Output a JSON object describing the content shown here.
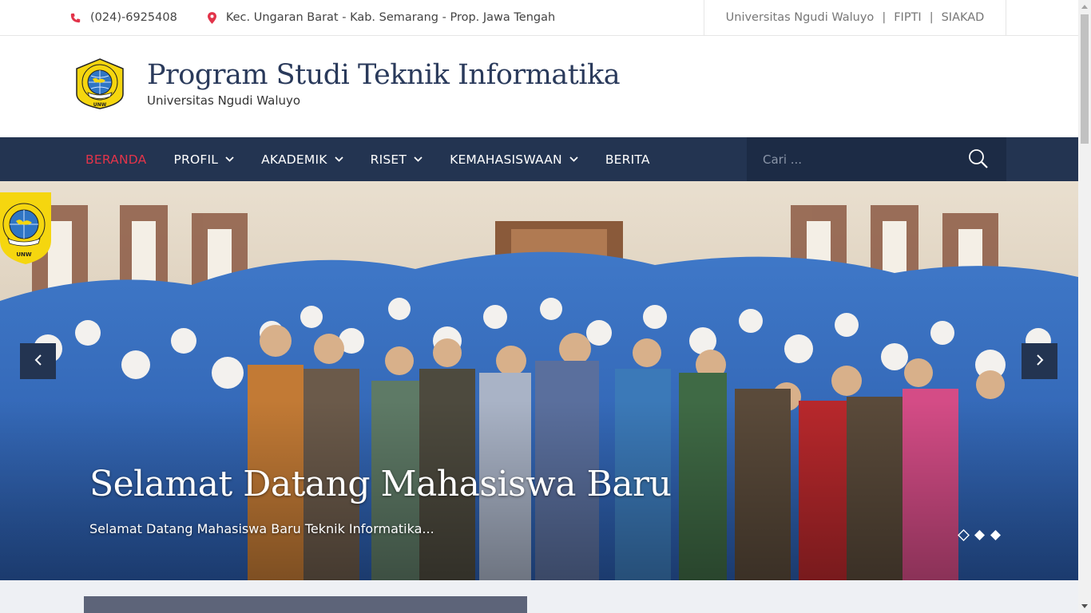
{
  "topbar": {
    "phone": "(024)-6925408",
    "address": "Kec. Ungaran Barat - Kab. Semarang - Prop. Jawa Tengah",
    "links": [
      "Universitas Ngudi Waluyo",
      "FIPTI",
      "SIAKAD"
    ],
    "separator": "|"
  },
  "header": {
    "title": "Program Studi Teknik Informatika",
    "subtitle": "Universitas Ngudi Waluyo",
    "logo_text": "UNW"
  },
  "nav": {
    "items": [
      {
        "label": "BERANDA",
        "active": true,
        "dropdown": false
      },
      {
        "label": "PROFIL",
        "active": false,
        "dropdown": true
      },
      {
        "label": "AKADEMIK",
        "active": false,
        "dropdown": true
      },
      {
        "label": "RISET",
        "active": false,
        "dropdown": true
      },
      {
        "label": "KEMAHASISWAAN",
        "active": false,
        "dropdown": true
      },
      {
        "label": "BERITA",
        "active": false,
        "dropdown": false
      }
    ],
    "search_placeholder": "Cari ..."
  },
  "slider": {
    "title": "Selamat Datang Mahasiswa Baru",
    "text": "Selamat Datang Mahasiswa Baru Teknik Informatika...",
    "slide_count": 3,
    "active_slide": 0
  },
  "colors": {
    "accent": "#e2344a",
    "nav_bg": "#233451",
    "title": "#2a3a5b"
  }
}
